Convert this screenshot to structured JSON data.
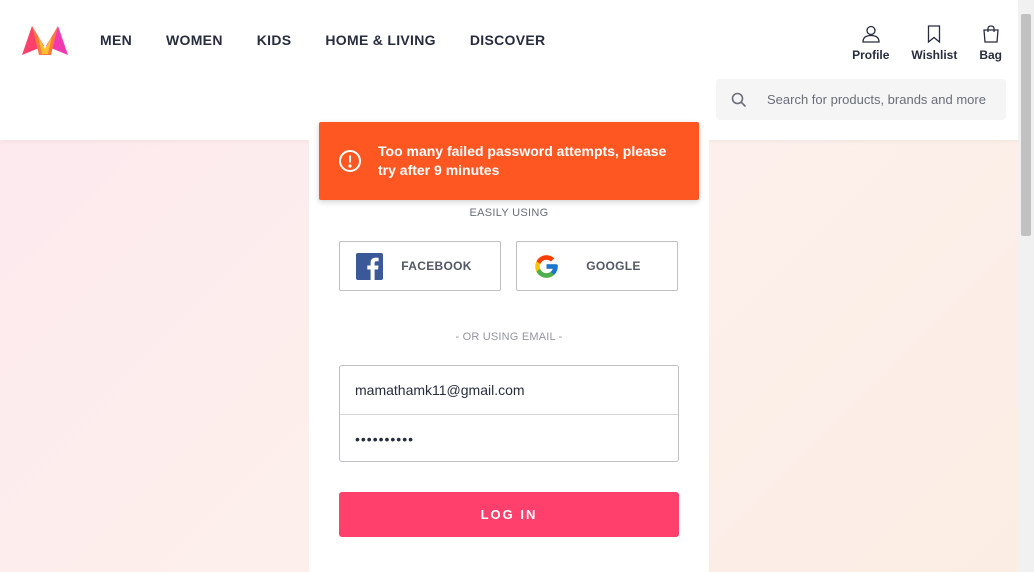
{
  "header": {
    "nav": [
      "MEN",
      "WOMEN",
      "KIDS",
      "HOME & LIVING",
      "DISCOVER"
    ],
    "actions": {
      "profile": "Profile",
      "wishlist": "Wishlist",
      "bag": "Bag"
    },
    "search": {
      "placeholder": "Search for products, brands and more",
      "value": ""
    }
  },
  "alert": {
    "message": "Too many failed password attempts, please try after 9 minutes",
    "color": "#ff5722"
  },
  "login": {
    "easily_using": "EASILY USING",
    "facebook_label": "FACEBOOK",
    "google_label": "GOOGLE",
    "or_email": "- OR USING EMAIL -",
    "email_value": "mamathamk11@gmail.com",
    "password_value": "••••••••••",
    "button_label": "LOG IN",
    "button_color": "#ff3f6c"
  },
  "icons": {
    "logo": "myntra-logo",
    "profile": "user-icon",
    "wishlist": "bookmark-icon",
    "bag": "bag-icon",
    "search": "search-icon",
    "alert": "exclamation-circle-icon",
    "facebook": "facebook-icon",
    "google": "google-icon"
  }
}
